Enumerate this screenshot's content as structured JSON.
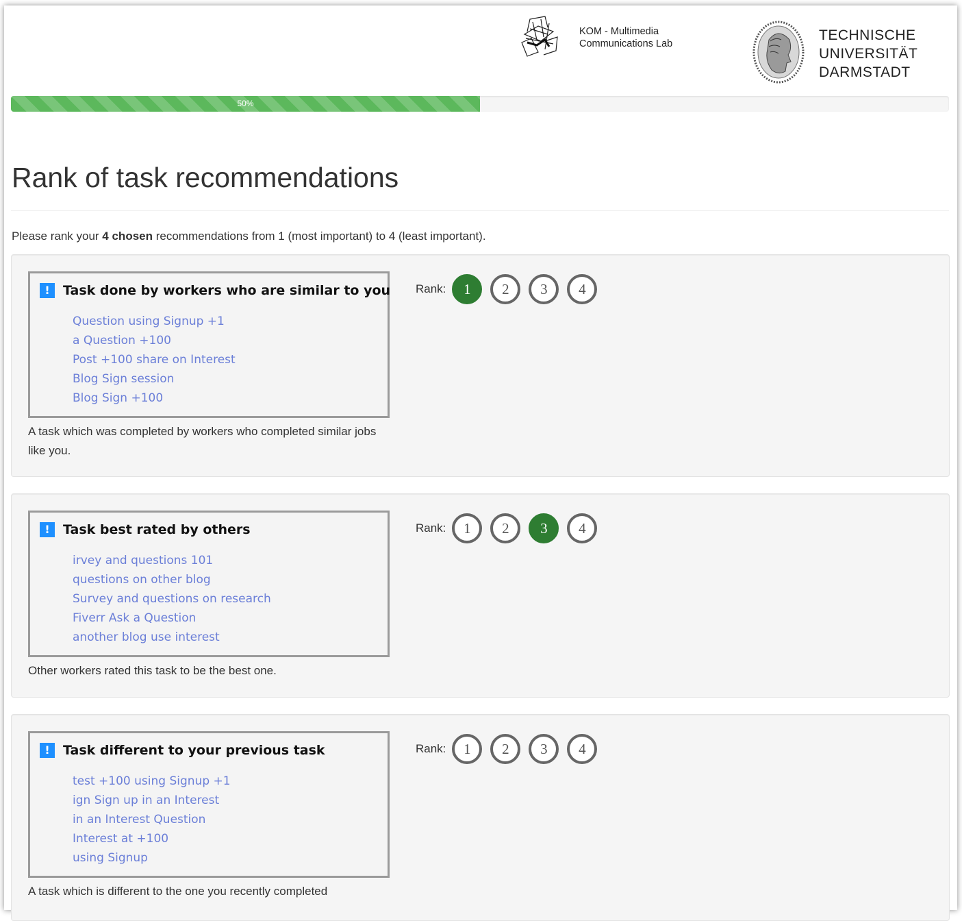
{
  "header": {
    "kom_lab": [
      "KOM - Multimedia",
      "Communications Lab"
    ],
    "university": [
      "TECHNISCHE",
      "UNIVERSITÄT",
      "DARMSTADT"
    ]
  },
  "progress": {
    "label": "50%",
    "value_percent": 50,
    "color": "#5cb85c"
  },
  "page": {
    "title": "Rank of task recommendations",
    "intro_before": "Please rank your ",
    "intro_bold": "4 chosen",
    "intro_after": " recommendations from 1 (most important) to 4 (least important)."
  },
  "rank_label": "Rank:",
  "rank_options": [
    "1",
    "2",
    "3",
    "4"
  ],
  "selected_color": "#2e7d32",
  "recommendations": [
    {
      "title": "Task done by workers who are similar to you",
      "lines": [
        "Question using Signup +1",
        "a Question +100",
        "Post +100 share on Interest",
        "Blog Sign session",
        "Blog Sign +100"
      ],
      "description": "A task which was completed by workers who completed similar jobs like you.",
      "selected_rank": "1"
    },
    {
      "title": "Task best rated by others",
      "lines": [
        "irvey and questions 101",
        "questions on other blog",
        "Survey and questions on research",
        "Fiverr Ask a Question",
        "another blog use interest"
      ],
      "description": "Other workers rated this task to be the best one.",
      "selected_rank": "3"
    },
    {
      "title": "Task different to your previous task",
      "lines": [
        "test +100 using Signup +1",
        "ign Sign up in an Interest",
        "in an Interest Question",
        "Interest at +100",
        "using Signup"
      ],
      "description": "A task which is different to the one you recently completed",
      "selected_rank": null
    }
  ]
}
